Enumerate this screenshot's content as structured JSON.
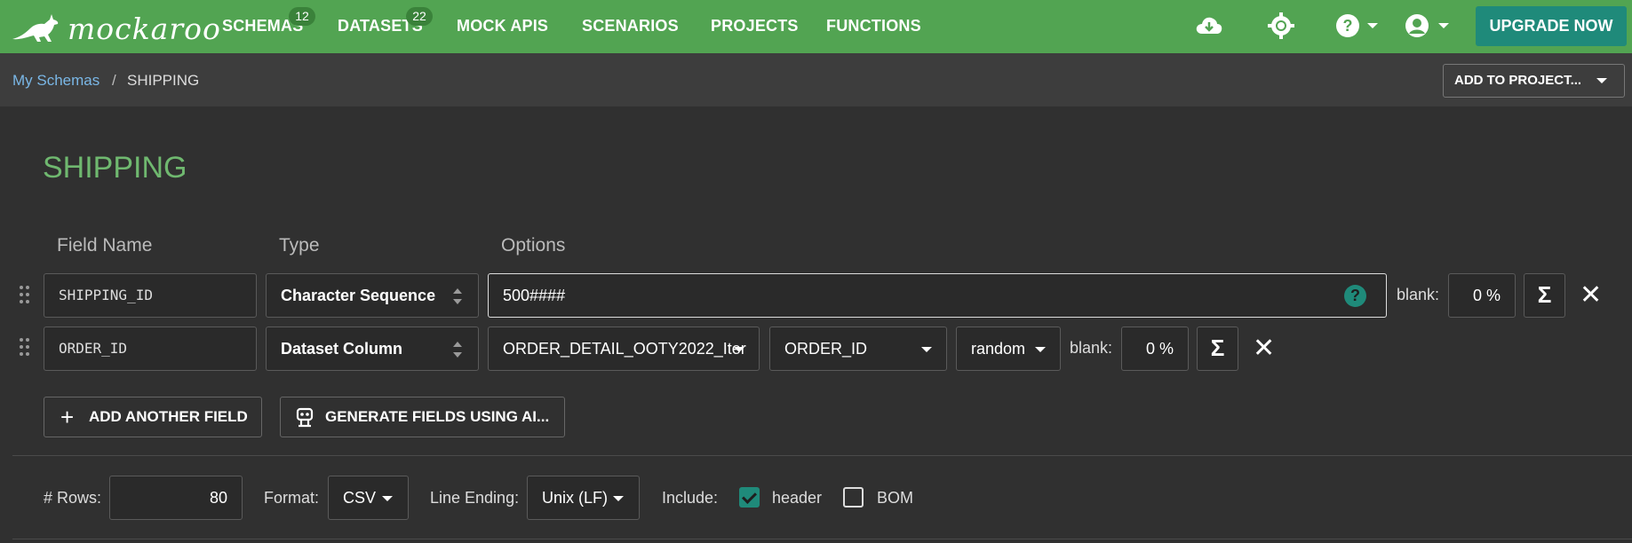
{
  "brand": {
    "name": "mockaroo"
  },
  "nav": {
    "items": [
      {
        "label": "SCHEMAS",
        "badge": "12"
      },
      {
        "label": "DATASETS",
        "badge": "22"
      },
      {
        "label": "MOCK APIS"
      },
      {
        "label": "SCENARIOS"
      },
      {
        "label": "PROJECTS"
      },
      {
        "label": "FUNCTIONS"
      }
    ],
    "icons": [
      "cloud-download-icon",
      "brightness-icon",
      "help-icon",
      "account-icon"
    ],
    "upgrade_label": "UPGRADE NOW"
  },
  "breadcrumb": {
    "link": "My Schemas",
    "separator": "/",
    "current": "SHIPPING",
    "add_to_project": "ADD TO PROJECT..."
  },
  "schema": {
    "title": "SHIPPING",
    "columns": {
      "field_name": "Field Name",
      "type": "Type",
      "options": "Options"
    },
    "fields": [
      {
        "name": "SHIPPING_ID",
        "type": "Character Sequence",
        "options_value": "500####",
        "blank_label": "blank:",
        "blank_pct": "0 %"
      },
      {
        "name": "ORDER_ID",
        "type": "Dataset Column",
        "dataset": "ORDER_DETAIL_OOTY2022_Iter",
        "column": "ORDER_ID",
        "mode": "random",
        "blank_label": "blank:",
        "blank_pct": "0 %"
      }
    ],
    "sigma": "Σ",
    "close": "✕",
    "add_field_label": "ADD ANOTHER FIELD",
    "generate_ai_label": "GENERATE FIELDS USING AI..."
  },
  "settings": {
    "rows_label": "# Rows:",
    "rows_value": "80",
    "format_label": "Format:",
    "format_value": "CSV",
    "line_ending_label": "Line Ending:",
    "line_ending_value": "Unix (LF)",
    "include_label": "Include:",
    "header_label": "header",
    "header_checked": true,
    "bom_label": "BOM",
    "bom_checked": false
  },
  "colors": {
    "nav_bg": "#52a452",
    "accent": "#1f8a7a",
    "title": "#6fb86f",
    "link": "#7ab7e6"
  }
}
